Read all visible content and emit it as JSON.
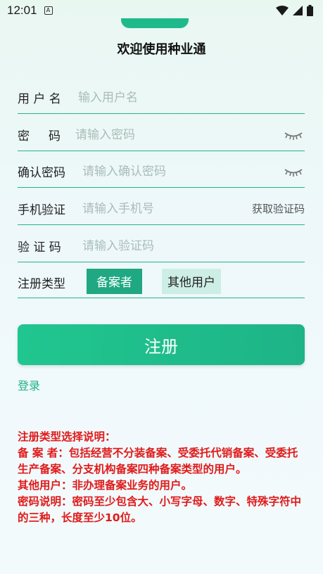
{
  "status_bar": {
    "time": "12:01",
    "icons": [
      "a-badge-icon",
      "wifi-icon",
      "signal-icon",
      "battery-icon"
    ]
  },
  "page": {
    "title": "欢迎使用种业通"
  },
  "form": {
    "username": {
      "label": "用 户 名",
      "placeholder": "输入用户名",
      "value": ""
    },
    "password": {
      "label": "密     码",
      "placeholder": "请输入密码",
      "value": ""
    },
    "confirm_password": {
      "label": "确认密码",
      "placeholder": "请输入确认密码",
      "value": ""
    },
    "phone": {
      "label": "手机验证",
      "placeholder": "请输入手机号",
      "value": "",
      "get_code_label": "获取验证码"
    },
    "code": {
      "label": "验 证 码",
      "placeholder": "请输入验证码",
      "value": ""
    },
    "register_type": {
      "label": "注册类型",
      "options": [
        "备案者",
        "其他用户"
      ],
      "selected": "备案者"
    }
  },
  "actions": {
    "register_label": "注册",
    "login_label": "登录"
  },
  "notes": {
    "line1": "注册类型选择说明：",
    "line2": "备 案 者：包括经营不分装备案、受委托代销备案、受委托生产备案、分支机构备案四种备案类型的用户。",
    "line3": "其他用户：非办理备案业务的用户。",
    "line4": "密码说明：密码至少包含大、小写字母、数字、特殊字符中的三种，长度至少10位。"
  },
  "colors": {
    "accent": "#1fba8c",
    "note_red": "#e01b1b"
  }
}
